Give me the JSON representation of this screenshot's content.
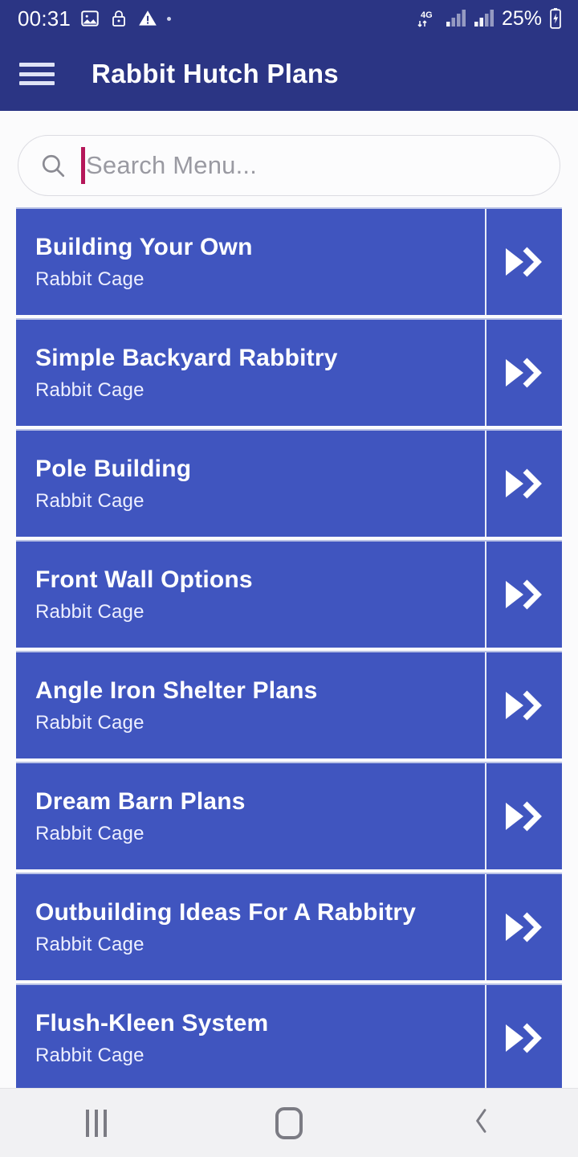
{
  "status_bar": {
    "time": "00:31",
    "icons_left": [
      "image-icon",
      "lock-icon",
      "warning-triangle-icon",
      "dot-indicator"
    ],
    "network_type": "4G",
    "icons_right": [
      "signal-bars-icon",
      "signal-bars-icon"
    ],
    "battery_percent": "25%",
    "battery_state": "charging",
    "background_color": "#2b3584",
    "text_color": "#ffffff"
  },
  "app_bar": {
    "menu_icon": "hamburger-menu-icon",
    "title": "Rabbit Hutch Plans",
    "background_color": "#2b3584"
  },
  "search": {
    "icon": "search-icon",
    "placeholder": "Search Menu...",
    "value": "",
    "caret_color": "#b5175a",
    "focused": true
  },
  "list": {
    "card_color": "#4055bf",
    "arrow_icon": "double-chevron-right-icon",
    "items": [
      {
        "title": "Building Your Own",
        "subtitle": "Rabbit Cage"
      },
      {
        "title": "Simple Backyard Rabbitry",
        "subtitle": "Rabbit Cage"
      },
      {
        "title": "Pole Building",
        "subtitle": "Rabbit Cage"
      },
      {
        "title": "Front Wall Options",
        "subtitle": "Rabbit Cage"
      },
      {
        "title": "Angle Iron Shelter Plans",
        "subtitle": "Rabbit Cage"
      },
      {
        "title": "Dream Barn Plans",
        "subtitle": "Rabbit Cage"
      },
      {
        "title": "Outbuilding Ideas For A Rabbitry",
        "subtitle": "Rabbit Cage"
      },
      {
        "title": "Flush-Kleen System",
        "subtitle": "Rabbit Cage"
      }
    ]
  },
  "nav_bar": {
    "recents_label": "recents-icon",
    "home_label": "home-icon",
    "back_label": "back-icon",
    "background_color": "#f1f1f3"
  }
}
